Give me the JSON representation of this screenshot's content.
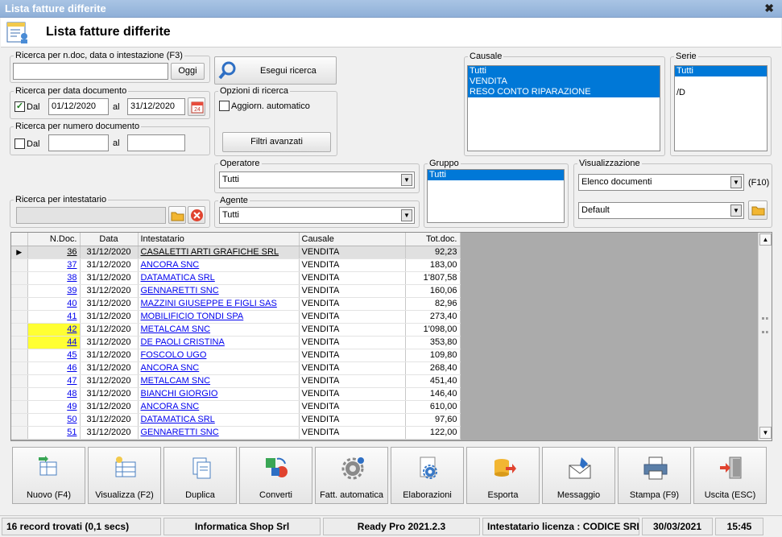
{
  "window": {
    "title": "Lista fatture differite",
    "close_glyph": "✖"
  },
  "header": {
    "title": "Lista fatture differite",
    "icon": "invoice-list-icon"
  },
  "search_text": {
    "legend": "Ricerca per n.doc, data o intestazione (F3)",
    "value": "",
    "today_label": "Oggi"
  },
  "search_button": {
    "label": "Esegui ricerca",
    "icon": "magnifier-icon"
  },
  "date_search": {
    "legend": "Ricerca per data documento",
    "dal_label": "Dal",
    "dal_checked": true,
    "from": "01/12/2020",
    "al_label": "al",
    "to": "31/12/2020",
    "calendar_text": "24"
  },
  "number_search": {
    "legend": "Ricerca per numero documento",
    "dal_label": "Dal",
    "dal_checked": false,
    "from": "",
    "al_label": "al",
    "to": ""
  },
  "search_options": {
    "legend": "Opzioni di ricerca",
    "auto_update_label": "Aggiorn. automatico",
    "auto_update_checked": false,
    "advanced_filters_label": "Filtri avanzati"
  },
  "causale": {
    "legend": "Causale",
    "items": [
      "Tutti",
      "VENDITA",
      "RESO CONTO RIPARAZIONE"
    ]
  },
  "serie": {
    "legend": "Serie",
    "items": [
      "Tutti",
      "/D"
    ]
  },
  "operatore": {
    "legend": "Operatore",
    "value": "Tutti"
  },
  "agente": {
    "legend": "Agente",
    "value": "Tutti"
  },
  "gruppo": {
    "legend": "Gruppo",
    "items": [
      "Tutti"
    ]
  },
  "visualizzazione": {
    "legend": "Visualizzazione",
    "mode": "Elenco documenti",
    "shortcut": "(F10)",
    "layout": "Default"
  },
  "intestatario": {
    "legend": "Ricerca per intestatario",
    "value": ""
  },
  "grid": {
    "columns": [
      "N.Doc.",
      "Data",
      "Intestatario",
      "Causale",
      "Tot.doc."
    ],
    "rows": [
      {
        "n": "36",
        "date": "31/12/2020",
        "name": "CASALETTI ARTI GRAFICHE SRL",
        "causale": "VENDITA",
        "tot": "92,23",
        "current": true,
        "highlight": false
      },
      {
        "n": "37",
        "date": "31/12/2020",
        "name": "ANCORA SNC",
        "causale": "VENDITA",
        "tot": "183,00",
        "current": false,
        "highlight": false
      },
      {
        "n": "38",
        "date": "31/12/2020",
        "name": "DATAMATICA SRL",
        "causale": "VENDITA",
        "tot": "1'807,58",
        "current": false,
        "highlight": false
      },
      {
        "n": "39",
        "date": "31/12/2020",
        "name": "GENNARETTI SNC",
        "causale": "VENDITA",
        "tot": "160,06",
        "current": false,
        "highlight": false
      },
      {
        "n": "40",
        "date": "31/12/2020",
        "name": "MAZZINI GIUSEPPE E FIGLI SAS",
        "causale": "VENDITA",
        "tot": "82,96",
        "current": false,
        "highlight": false
      },
      {
        "n": "41",
        "date": "31/12/2020",
        "name": "MOBILIFICIO TONDI SPA",
        "causale": "VENDITA",
        "tot": "273,40",
        "current": false,
        "highlight": false
      },
      {
        "n": "42",
        "date": "31/12/2020",
        "name": "METALCAM SNC",
        "causale": "VENDITA",
        "tot": "1'098,00",
        "current": false,
        "highlight": true
      },
      {
        "n": "44",
        "date": "31/12/2020",
        "name": "DE PAOLI CRISTINA",
        "causale": "VENDITA",
        "tot": "353,80",
        "current": false,
        "highlight": true
      },
      {
        "n": "45",
        "date": "31/12/2020",
        "name": "FOSCOLO UGO",
        "causale": "VENDITA",
        "tot": "109,80",
        "current": false,
        "highlight": false
      },
      {
        "n": "46",
        "date": "31/12/2020",
        "name": "ANCORA SNC",
        "causale": "VENDITA",
        "tot": "268,40",
        "current": false,
        "highlight": false
      },
      {
        "n": "47",
        "date": "31/12/2020",
        "name": "METALCAM SNC",
        "causale": "VENDITA",
        "tot": "451,40",
        "current": false,
        "highlight": false
      },
      {
        "n": "48",
        "date": "31/12/2020",
        "name": "BIANCHI GIORGIO",
        "causale": "VENDITA",
        "tot": "146,40",
        "current": false,
        "highlight": false
      },
      {
        "n": "49",
        "date": "31/12/2020",
        "name": "ANCORA SNC",
        "causale": "VENDITA",
        "tot": "610,00",
        "current": false,
        "highlight": false
      },
      {
        "n": "50",
        "date": "31/12/2020",
        "name": "DATAMATICA SRL",
        "causale": "VENDITA",
        "tot": "97,60",
        "current": false,
        "highlight": false
      },
      {
        "n": "51",
        "date": "31/12/2020",
        "name": "GENNARETTI SNC",
        "causale": "VENDITA",
        "tot": "122,00",
        "current": false,
        "highlight": false
      }
    ]
  },
  "toolbar": [
    {
      "label": "Nuovo (F4)",
      "icon": "new-document-icon"
    },
    {
      "label": "Visualizza (F2)",
      "icon": "view-table-icon"
    },
    {
      "label": "Duplica",
      "icon": "duplicate-icon"
    },
    {
      "label": "Converti",
      "icon": "convert-icon"
    },
    {
      "label": "Fatt. automatica",
      "icon": "auto-invoice-gear-icon"
    },
    {
      "label": "Elaborazioni",
      "icon": "processing-gear-icon"
    },
    {
      "label": "Esporta",
      "icon": "export-icon"
    },
    {
      "label": "Messaggio",
      "icon": "message-icon"
    },
    {
      "label": "Stampa (F9)",
      "icon": "printer-icon"
    },
    {
      "label": "Uscita (ESC)",
      "icon": "exit-door-icon"
    }
  ],
  "statusbar": {
    "records": "16 record trovati (0,1 secs)",
    "company": "Informatica Shop Srl",
    "version": "Ready Pro 2021.2.3",
    "license": "Intestatario licenza : CODICE SRL",
    "date": "30/03/2021",
    "time": "15:45"
  },
  "colors": {
    "selection": "#0078d7",
    "highlight": "#ffff33",
    "link": "#0000ee",
    "titlebar": "#a9c4e4"
  }
}
